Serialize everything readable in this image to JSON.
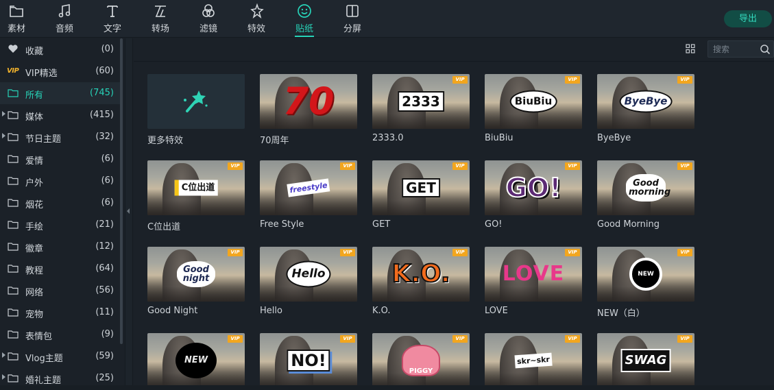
{
  "toolbar": {
    "tabs": [
      {
        "label": "素材",
        "icon": "folder-icon"
      },
      {
        "label": "音频",
        "icon": "music-note-icon"
      },
      {
        "label": "文字",
        "icon": "text-icon"
      },
      {
        "label": "转场",
        "icon": "transition-icon"
      },
      {
        "label": "滤镜",
        "icon": "filter-icon"
      },
      {
        "label": "特效",
        "icon": "effects-star-icon"
      },
      {
        "label": "贴纸",
        "icon": "sticker-smile-icon"
      },
      {
        "label": "分屏",
        "icon": "split-screen-icon"
      }
    ],
    "active_tab": "贴纸",
    "export_label": "导出"
  },
  "sidebar": {
    "items": [
      {
        "name": "收藏",
        "count": "(0)",
        "icon": "heart-icon"
      },
      {
        "name": "VIP精选",
        "count": "(60)",
        "icon": "vip-icon",
        "badge": "VIP"
      },
      {
        "name": "所有",
        "count": "(745)",
        "icon": "folder-icon"
      },
      {
        "name": "媒体",
        "count": "(415)",
        "icon": "folder-icon"
      },
      {
        "name": "节日主题",
        "count": "(32)",
        "icon": "folder-icon"
      },
      {
        "name": "爱情",
        "count": "(6)",
        "icon": "folder-icon"
      },
      {
        "name": "户外",
        "count": "(6)",
        "icon": "folder-icon"
      },
      {
        "name": "烟花",
        "count": "(6)",
        "icon": "folder-icon"
      },
      {
        "name": "手绘",
        "count": "(21)",
        "icon": "folder-icon"
      },
      {
        "name": "徽章",
        "count": "(12)",
        "icon": "folder-icon"
      },
      {
        "name": "教程",
        "count": "(64)",
        "icon": "folder-icon"
      },
      {
        "name": "网络",
        "count": "(56)",
        "icon": "folder-icon"
      },
      {
        "name": "宠物",
        "count": "(11)",
        "icon": "folder-icon"
      },
      {
        "name": "表情包",
        "count": "(9)",
        "icon": "folder-icon"
      },
      {
        "name": "Vlog主题",
        "count": "(59)",
        "icon": "folder-icon"
      },
      {
        "name": "婚礼主题",
        "count": "(25)",
        "icon": "folder-icon"
      }
    ],
    "selected": "所有"
  },
  "search": {
    "placeholder": "搜索"
  },
  "stickers": [
    {
      "label": "更多特效",
      "vip": false,
      "art": ""
    },
    {
      "label": "70周年",
      "vip": false,
      "art": "70"
    },
    {
      "label": "2333.0",
      "vip": true,
      "art": "2333"
    },
    {
      "label": "BiuBiu",
      "vip": true,
      "art": "BiuBiu"
    },
    {
      "label": "ByeBye",
      "vip": true,
      "art": "ByeBye"
    },
    {
      "label": "C位出道",
      "vip": true,
      "art": "C位出道"
    },
    {
      "label": "Free Style",
      "vip": true,
      "art": "freestyle"
    },
    {
      "label": "GET",
      "vip": true,
      "art": "GET"
    },
    {
      "label": "GO!",
      "vip": true,
      "art": "GO!"
    },
    {
      "label": "Good Morning",
      "vip": true,
      "art": "Good morning"
    },
    {
      "label": "Good Night",
      "vip": true,
      "art": "Good night"
    },
    {
      "label": "Hello",
      "vip": true,
      "art": "Hello"
    },
    {
      "label": "K.O.",
      "vip": true,
      "art": "K.O."
    },
    {
      "label": "LOVE",
      "vip": true,
      "art": "LOVE"
    },
    {
      "label": "NEW（白）",
      "vip": true,
      "art": "NEW"
    },
    {
      "label": "",
      "vip": true,
      "art": "NEW"
    },
    {
      "label": "",
      "vip": true,
      "art": "NO!"
    },
    {
      "label": "",
      "vip": true,
      "art": "PIGGY"
    },
    {
      "label": "",
      "vip": true,
      "art": "skr~skr"
    },
    {
      "label": "",
      "vip": true,
      "art": "SWAG"
    }
  ],
  "vip_tag": "VIP"
}
